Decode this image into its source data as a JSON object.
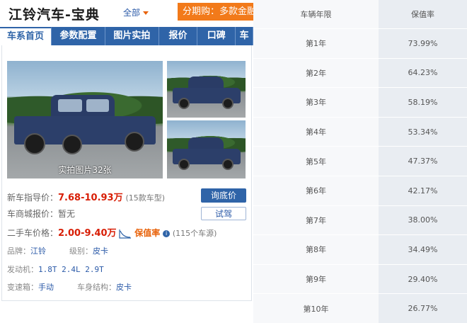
{
  "header": {
    "title": "江铃汽车-宝典",
    "scope": "全部",
    "promo": "分期购：多款金融"
  },
  "tabs": [
    {
      "label": "车系首页",
      "active": true
    },
    {
      "label": "参数配置"
    },
    {
      "label": "图片实拍"
    },
    {
      "label": "报价"
    },
    {
      "label": "口碑"
    },
    {
      "label": "车"
    }
  ],
  "gallery": {
    "caption": "实拍图片32张"
  },
  "pricing": {
    "new_label": "新车指导价：",
    "new_price": "7.68-10.93万",
    "new_note": "(15款车型)",
    "inquiry_button": "询底价",
    "mall_label": "车商城报价：",
    "mall_value": "暂无",
    "trial_button": "试驾",
    "used_label": "二手车价格：",
    "used_price": "2.00-9.40万",
    "retention_link": "保值率",
    "used_note": "(115个车源)"
  },
  "specs": {
    "brand_label": "品牌：",
    "brand_value": "江铃",
    "level_label": "级别：",
    "level_value": "皮卡",
    "engine_label": "发动机：",
    "engine_values": "1.8T 2.4L 2.9T",
    "gearbox_label": "变速箱：",
    "gearbox_value": "手动",
    "body_label": "车身结构：",
    "body_value": "皮卡"
  },
  "retention_table": {
    "headers": [
      "车辆年限",
      "保值率"
    ],
    "rows": [
      [
        "第1年",
        "73.99%"
      ],
      [
        "第2年",
        "64.23%"
      ],
      [
        "第3年",
        "58.19%"
      ],
      [
        "第4年",
        "53.34%"
      ],
      [
        "第5年",
        "47.37%"
      ],
      [
        "第6年",
        "42.17%"
      ],
      [
        "第7年",
        "38.00%"
      ],
      [
        "第8年",
        "34.49%"
      ],
      [
        "第9年",
        "29.40%"
      ],
      [
        "第10年",
        "26.77%"
      ]
    ]
  },
  "colors": {
    "brand_blue": "#2f64a8",
    "price_red": "#d81e06",
    "promo_orange": "#f27a1a"
  }
}
